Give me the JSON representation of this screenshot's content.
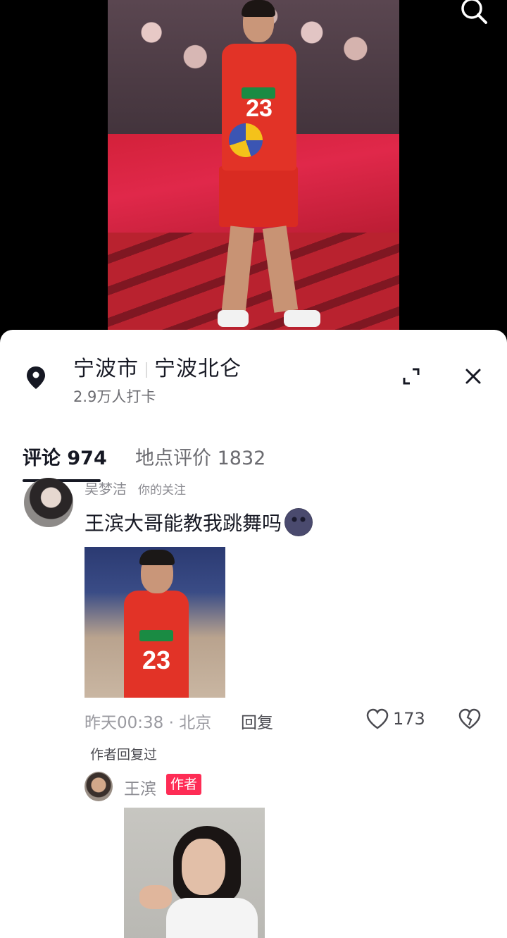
{
  "video": {
    "jersey_number": "23"
  },
  "location": {
    "city": "宁波市",
    "district": "宁波北仑",
    "checkins": "2.9万人打卡"
  },
  "tabs": [
    {
      "label": "评论 974",
      "active": true
    },
    {
      "label": "地点评价 1832",
      "active": false
    }
  ],
  "comment": {
    "username": "吴梦洁",
    "relation": "你的关注",
    "text": "王滨大哥能教我跳舞吗",
    "emoji": "new-moon-face",
    "image_jersey_number": "23",
    "meta": "昨天00:38 · 北京",
    "reply_label": "回复",
    "likes": "173",
    "author_replied": "作者回复过"
  },
  "reply": {
    "username": "王滨",
    "badge": "作者"
  },
  "colors": {
    "accent": "#fe2c55",
    "text_primary": "#161823",
    "text_secondary": "#8a8a90"
  }
}
